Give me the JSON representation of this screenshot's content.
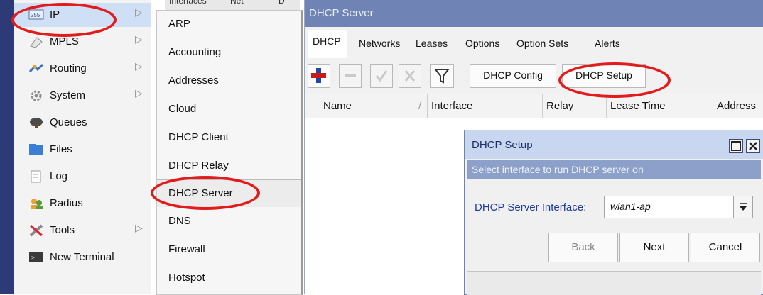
{
  "hidden_tabs": [
    "Interfaces",
    "Net",
    "D"
  ],
  "main_menu": [
    {
      "label": "IP",
      "icon": "ip-icon",
      "has_submenu": true,
      "selected": true
    },
    {
      "label": "MPLS",
      "icon": "mpls-icon",
      "has_submenu": true
    },
    {
      "label": "Routing",
      "icon": "routing-icon",
      "has_submenu": true
    },
    {
      "label": "System",
      "icon": "gear-icon",
      "has_submenu": true
    },
    {
      "label": "Queues",
      "icon": "queues-icon",
      "has_submenu": false
    },
    {
      "label": "Files",
      "icon": "folder-icon",
      "has_submenu": false
    },
    {
      "label": "Log",
      "icon": "log-icon",
      "has_submenu": false
    },
    {
      "label": "Radius",
      "icon": "users-icon",
      "has_submenu": false
    },
    {
      "label": "Tools",
      "icon": "tools-icon",
      "has_submenu": true
    },
    {
      "label": "New Terminal",
      "icon": "terminal-icon",
      "has_submenu": false
    }
  ],
  "ip_submenu": [
    "ARP",
    "Accounting",
    "Addresses",
    "Cloud",
    "DHCP Client",
    "DHCP Relay",
    "DHCP Server",
    "DNS",
    "Firewall",
    "Hotspot"
  ],
  "dhcp_server": {
    "title": "DHCP Server",
    "tabs": [
      "DHCP",
      "Networks",
      "Leases",
      "Options",
      "Option Sets",
      "Alerts"
    ],
    "toolbar": {
      "add_icon": "plus-icon",
      "remove_icon": "minus-icon",
      "enable_icon": "check-icon",
      "disable_icon": "x-icon",
      "filter_icon": "filter-icon",
      "config_label": "DHCP Config",
      "setup_label": "DHCP Setup"
    },
    "columns": [
      "Name",
      "Interface",
      "Relay",
      "Lease Time",
      "Address"
    ]
  },
  "dhcp_setup": {
    "title": "DHCP Setup",
    "banner": "Select interface to run DHCP server on",
    "interface_label": "DHCP Server Interface:",
    "interface_value": "wlan1-ap",
    "back_label": "Back",
    "next_label": "Next",
    "cancel_label": "Cancel"
  },
  "colors": {
    "title_bar": "#6f84b5",
    "dialog_title_bar": "#c9d6ef",
    "annotation": "#e21c1c",
    "left_strip": "#2c3a78"
  }
}
